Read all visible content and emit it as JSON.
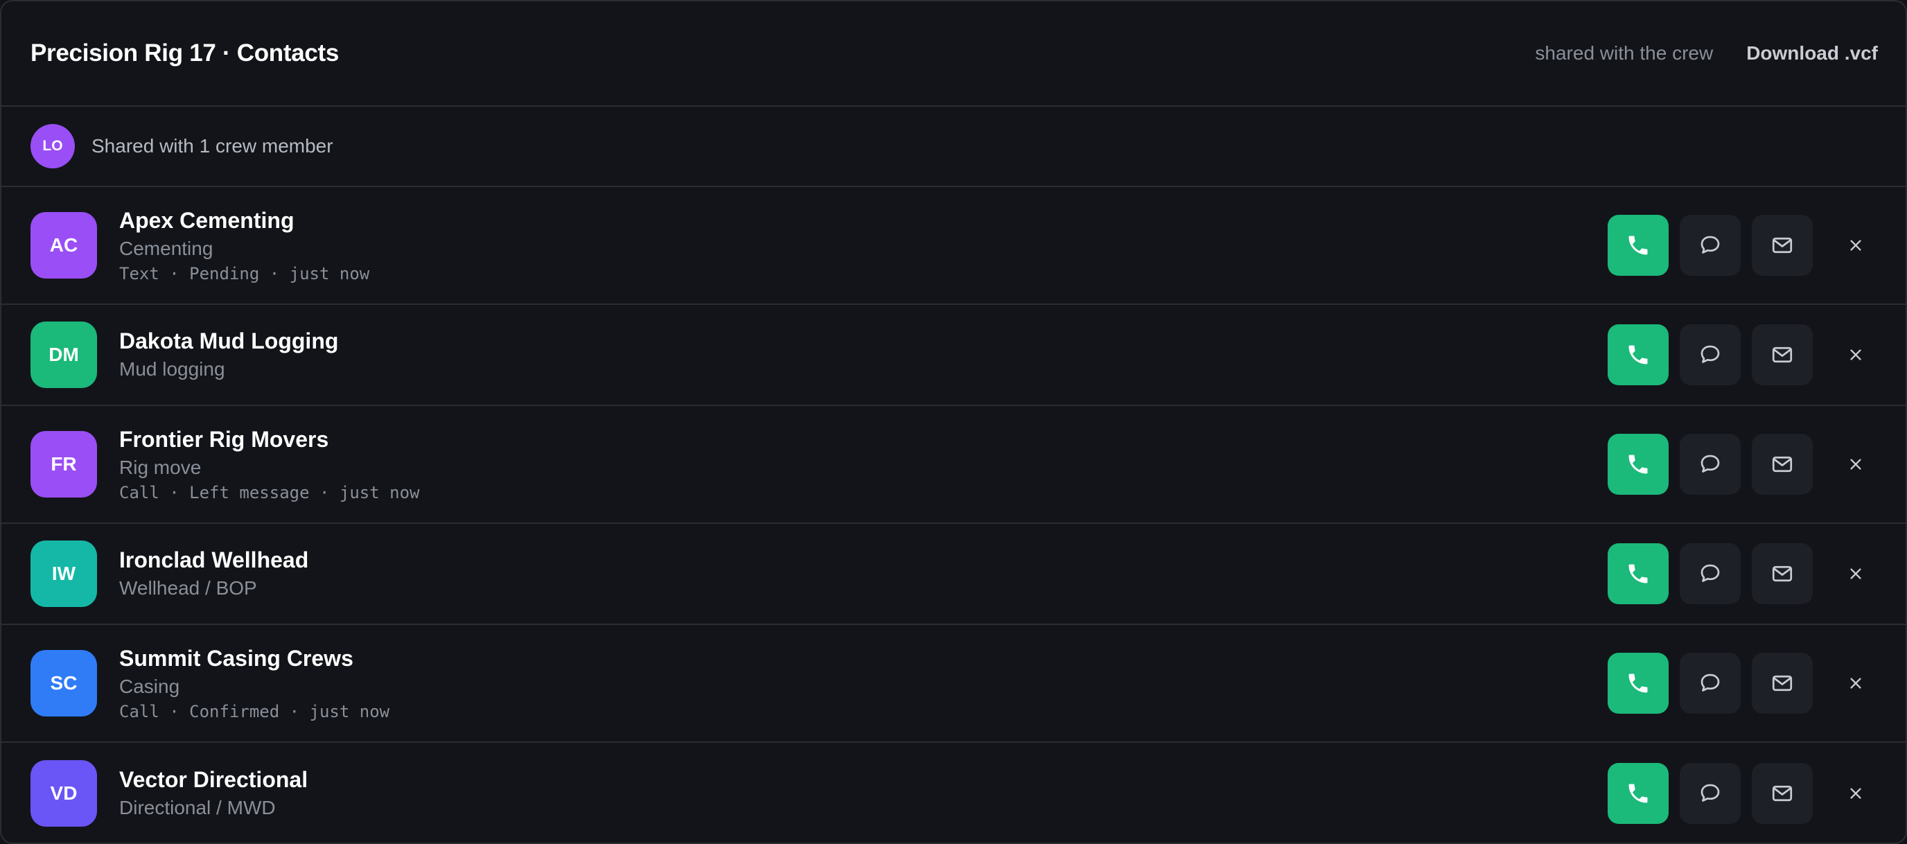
{
  "header": {
    "title": "Precision Rig 17 · Contacts",
    "shared_note": "shared with the crew",
    "download_label": "Download .vcf"
  },
  "share": {
    "avatar_initials": "LO",
    "text": "Shared with 1 crew member"
  },
  "icons": {
    "call": "phone-icon",
    "message": "chat-bubble-icon",
    "email": "mail-icon",
    "remove": "close-icon"
  },
  "colors": {
    "call_button": "#1bb97a",
    "purple": "#9a4ef5",
    "green": "#1bb97a",
    "teal": "#15b8a6",
    "blue": "#2f7cf6",
    "indigo": "#6a55f6"
  },
  "contacts": [
    {
      "initials": "AC",
      "name": "Apex Cementing",
      "role": "Cementing",
      "status": "Text · Pending · just now",
      "color": "#9a4ef5"
    },
    {
      "initials": "DM",
      "name": "Dakota Mud Logging",
      "role": "Mud logging",
      "status": "",
      "color": "#1bb97a"
    },
    {
      "initials": "FR",
      "name": "Frontier Rig Movers",
      "role": "Rig move",
      "status": "Call · Left message · just now",
      "color": "#9a4ef5"
    },
    {
      "initials": "IW",
      "name": "Ironclad Wellhead",
      "role": "Wellhead / BOP",
      "status": "",
      "color": "#15b8a6"
    },
    {
      "initials": "SC",
      "name": "Summit Casing Crews",
      "role": "Casing",
      "status": "Call · Confirmed · just now",
      "color": "#2f7cf6"
    },
    {
      "initials": "VD",
      "name": "Vector Directional",
      "role": "Directional / MWD",
      "status": "",
      "color": "#6a55f6"
    }
  ]
}
